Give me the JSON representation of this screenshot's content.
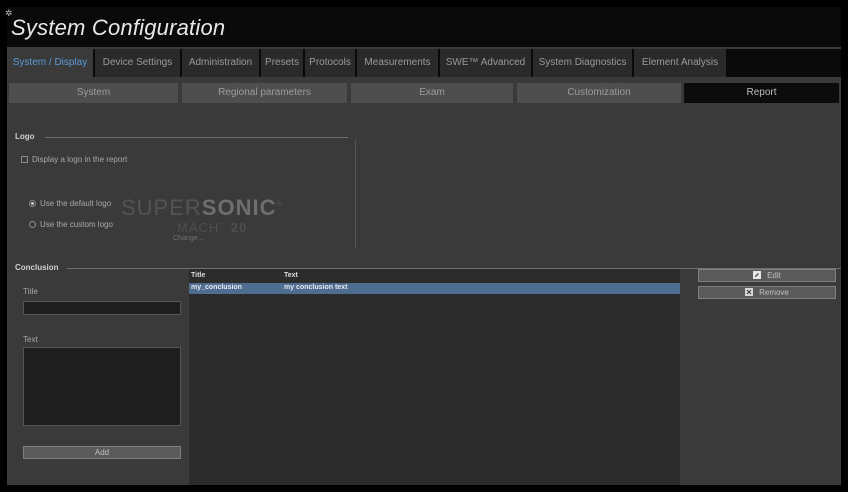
{
  "window": {
    "title": "System Configuration"
  },
  "tabs": [
    {
      "label": "System / Display",
      "active": true
    },
    {
      "label": "Device Settings"
    },
    {
      "label": "Administration"
    },
    {
      "label": "Presets"
    },
    {
      "label": "Protocols"
    },
    {
      "label": "Measurements"
    },
    {
      "label": "SWE™ Advanced"
    },
    {
      "label": "System Diagnostics"
    },
    {
      "label": "Element Analysis"
    }
  ],
  "subtabs": [
    {
      "label": "System"
    },
    {
      "label": "Regional parameters"
    },
    {
      "label": "Exam"
    },
    {
      "label": "Customization"
    },
    {
      "label": "Report",
      "active": true
    }
  ],
  "logo": {
    "section_label": "Logo",
    "display_logo_label": "Display a logo in the report",
    "display_logo_checked": false,
    "default_logo_label": "Use the default logo",
    "default_logo_selected": true,
    "custom_logo_label": "Use the custom logo",
    "custom_logo_selected": false,
    "brand_light": "SUPER",
    "brand_bold": "SONIC",
    "brand_mark": "®",
    "product_light": "MACH",
    "product_tm": "™",
    "product_num": "20",
    "change_link": "Change..."
  },
  "conclusion": {
    "section_label": "Conclusion",
    "title_label": "Title",
    "title_value": "",
    "text_label": "Text",
    "text_value": "",
    "add_button": "Add",
    "table": {
      "columns": [
        "Title",
        "Text"
      ],
      "rows": [
        {
          "title": "my_conclusion",
          "text": "my conclusion text",
          "selected": true
        }
      ]
    },
    "edit_button": "Edit",
    "remove_button": "Remove"
  },
  "colors": {
    "accent": "#5b9ad6",
    "selected_row": "#4f6d90",
    "panel": "#3a3a3a"
  }
}
